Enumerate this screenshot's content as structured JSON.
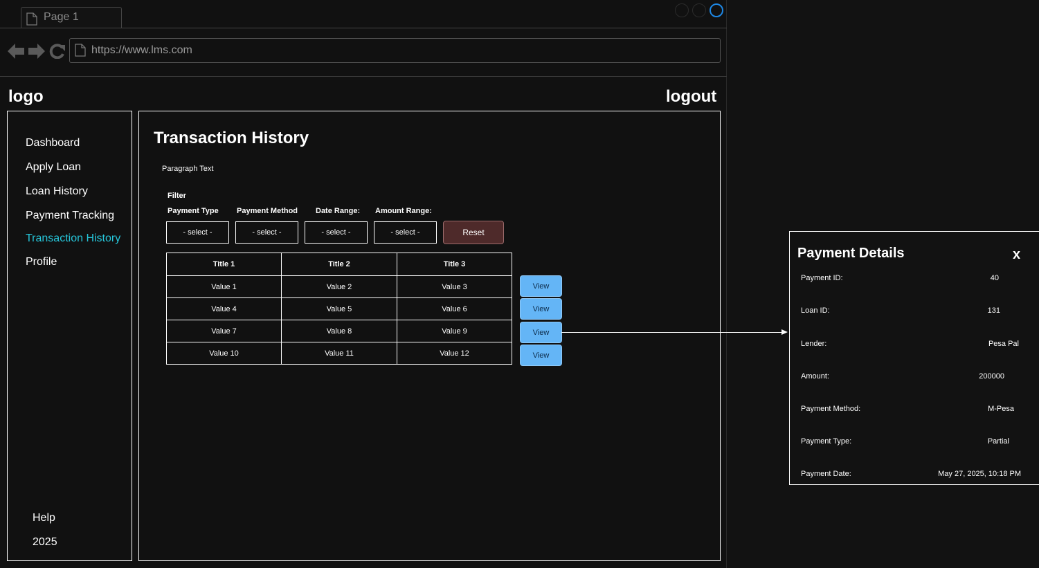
{
  "browser": {
    "tab_label": "Page 1",
    "url": "https://www.lms.com",
    "icons": [
      "page-icon",
      "back-arrow-icon",
      "forward-arrow-icon",
      "reload-icon"
    ]
  },
  "header": {
    "logo": "logo",
    "logout": "logout"
  },
  "sidebar": {
    "items": [
      {
        "label": "Dashboard"
      },
      {
        "label": "Apply Loan"
      },
      {
        "label": "Loan History"
      },
      {
        "label": "Payment Tracking"
      },
      {
        "label": "Transaction History",
        "active": true
      },
      {
        "label": "Profile"
      }
    ],
    "help": "Help",
    "year": "2025",
    "active_color": "#26c6da"
  },
  "main": {
    "title": "Transaction History",
    "paragraph": "Paragraph Text",
    "filter": {
      "title": "Filter",
      "labels": [
        "Payment Type",
        "Payment Method",
        "Date Range:",
        "Amount Range:"
      ],
      "selects": [
        "- select -",
        "- select -",
        "- select -",
        "- select -"
      ],
      "reset_label": "Reset"
    },
    "table": {
      "headers": [
        "Title 1",
        "Title 2",
        "Title 3"
      ],
      "rows": [
        [
          "Value 1",
          "Value 2",
          "Value 3"
        ],
        [
          "Value 4",
          "Value 5",
          "Value 6"
        ],
        [
          "Value 7",
          "Value 8",
          "Value 9"
        ],
        [
          "Value 10",
          "Value 11",
          "Value 12"
        ]
      ],
      "view_label": "View"
    }
  },
  "popup": {
    "title": "Payment Details",
    "close": "x",
    "details": [
      {
        "label": "Payment ID:",
        "value": "40"
      },
      {
        "label": "Loan ID:",
        "value": "131"
      },
      {
        "label": "Lender:",
        "value": "Pesa Pal"
      },
      {
        "label": "Amount:",
        "value": "200000"
      },
      {
        "label": "Payment Method:",
        "value": "M-Pesa"
      },
      {
        "label": "Payment Type:",
        "value": "Partial"
      },
      {
        "label": "Payment Date:",
        "value": "May 27, 2025, 10:18 PM"
      }
    ]
  },
  "colors": {
    "background": "#121212",
    "accent": "#26c6da",
    "view_button": "#64b5f6",
    "reset_button": "#4e2a2a",
    "window_active": "#1e88e5"
  }
}
